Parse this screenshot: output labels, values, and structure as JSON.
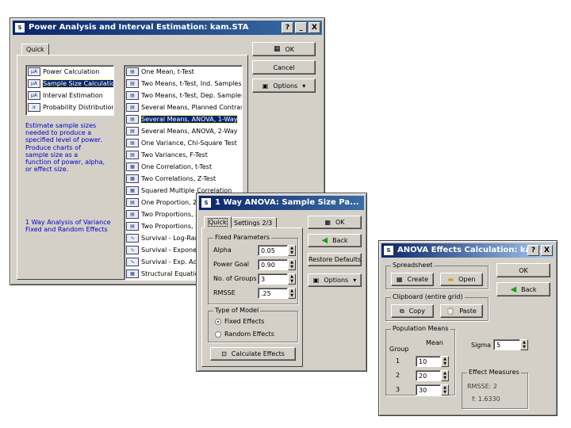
{
  "w1": {
    "title": "Power Analysis and Interval Estimation: kam.STA",
    "help": "?",
    "min": "_",
    "close": "X",
    "tab": "Quick",
    "ok": "OK",
    "cancel": "Cancel",
    "options": "Options",
    "left_items": [
      {
        "icon": "μA",
        "label": "Power Calculation"
      },
      {
        "icon": "μA",
        "label": "Sample Size Calculation"
      },
      {
        "icon": "μA",
        "label": "Interval Estimation"
      },
      {
        "icon": "α",
        "label": "Probability Distributions"
      }
    ],
    "desc1": "Estimate sample sizes needed to produce a specified level of power.",
    "desc2": "Produce charts of sample size as a function of power, alpha, or effect size.",
    "desc3": "1 Way Analysis of Variance Fixed and Random Effects",
    "right_items": [
      {
        "icon": "▤",
        "label": "One Mean, t-Test"
      },
      {
        "icon": "▤",
        "label": "Two Means, t-Test, Ind. Samples"
      },
      {
        "icon": "▤",
        "label": "Two Means, t-Test, Dep. Samples"
      },
      {
        "icon": "▤",
        "label": "Several Means, Planned Contrast"
      },
      {
        "icon": "▤",
        "label": "Several Means, ANOVA, 1-Way"
      },
      {
        "icon": "▤",
        "label": "Several Means, ANOVA, 2-Way"
      },
      {
        "icon": "▤",
        "label": "One Variance, Chi-Square Test"
      },
      {
        "icon": "▤",
        "label": "Two Variances, F-Test"
      },
      {
        "icon": "▦",
        "label": "One Correlation, t-Test"
      },
      {
        "icon": "▦",
        "label": "Two Correlations, Z-Test"
      },
      {
        "icon": "▦",
        "label": "Squared Multiple Correlation"
      },
      {
        "icon": "▤",
        "label": "One Proportion, Z, C..."
      },
      {
        "icon": "▤",
        "label": "Two Proportions, Z-T..."
      },
      {
        "icon": "▤",
        "label": "Two Proportions, Pai..."
      },
      {
        "icon": "∿",
        "label": "Survival - Log-Rank T..."
      },
      {
        "icon": "∿",
        "label": "Survival - Exponentia..."
      },
      {
        "icon": "∿",
        "label": "Survival - Exp. Acc..."
      },
      {
        "icon": "▦",
        "label": "Structural Equation M..."
      }
    ]
  },
  "w2": {
    "title": "1 Way ANOVA: Sample Size Pa...",
    "tab_quick": "Quick",
    "tab_settings": "Settings 2/3",
    "ok": "OK",
    "back": "Back",
    "restore": "Restore Defaults",
    "options": "Options",
    "fixed_params": "Fixed Parameters",
    "alpha_label": "Alpha",
    "alpha": "0.05",
    "power_label": "Power Goal",
    "power": "0.90",
    "groups_label": "No. of Groups",
    "groups": "3",
    "rmsse_label": "RMSSE",
    "rmsse": ".25",
    "model_label": "Type of Model",
    "fixed": "Fixed Effects",
    "random": "Random Effects",
    "calc": "Calculate Effects"
  },
  "w3": {
    "title": "ANOVA Effects Calculation: kam....",
    "ok": "OK",
    "back": "Back",
    "spreadsheet": "Spreadsheet",
    "create": "Create",
    "open": "Open",
    "clipboard": "Clipboard (entire grid)",
    "copy": "Copy",
    "paste": "Paste",
    "popmeans": "Population Means",
    "group_h": "Group",
    "mean_h": "Mean",
    "groups": [
      {
        "g": "1",
        "m": "10"
      },
      {
        "g": "2",
        "m": "20"
      },
      {
        "g": "3",
        "m": "30"
      }
    ],
    "sigma_label": "Sigma",
    "sigma": "5",
    "effect": "Effect Measures",
    "rmsse": "RMSSE: 2",
    "f": "f:   1.6330"
  }
}
